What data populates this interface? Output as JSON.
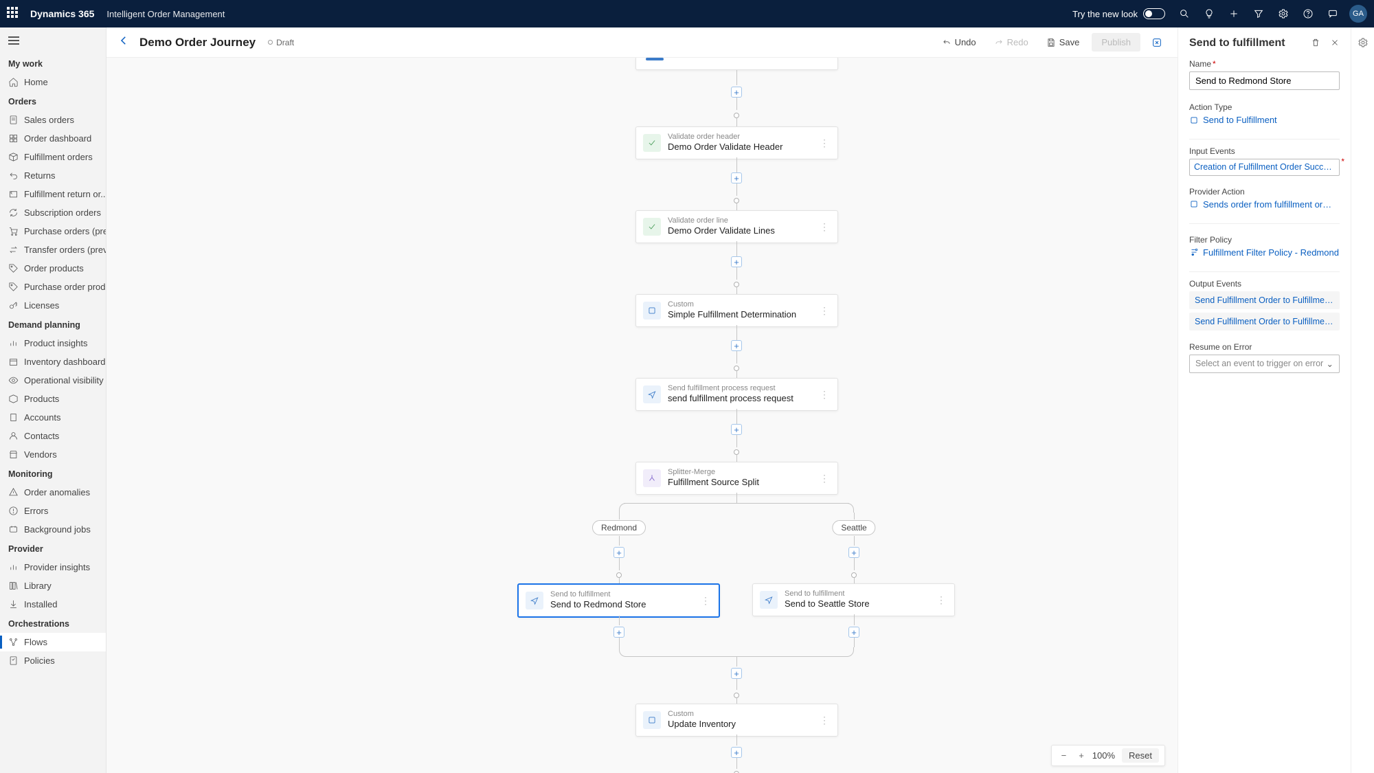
{
  "topbar": {
    "brand": "Dynamics 365",
    "module": "Intelligent Order Management",
    "trynew": "Try the new look",
    "avatar": "GA"
  },
  "sidebar": {
    "groups": [
      {
        "label": "My work",
        "items": [
          {
            "label": "Home"
          }
        ]
      },
      {
        "label": "Orders",
        "items": [
          {
            "label": "Sales orders"
          },
          {
            "label": "Order dashboard"
          },
          {
            "label": "Fulfillment orders"
          },
          {
            "label": "Returns"
          },
          {
            "label": "Fulfillment return or..."
          },
          {
            "label": "Subscription orders"
          },
          {
            "label": "Purchase orders (pre..."
          },
          {
            "label": "Transfer orders (previ..."
          },
          {
            "label": "Order products"
          },
          {
            "label": "Purchase order prod..."
          },
          {
            "label": "Licenses"
          }
        ]
      },
      {
        "label": "Demand planning",
        "items": [
          {
            "label": "Product insights"
          },
          {
            "label": "Inventory dashboard"
          },
          {
            "label": "Operational visibility ..."
          },
          {
            "label": "Products"
          },
          {
            "label": "Accounts"
          },
          {
            "label": "Contacts"
          },
          {
            "label": "Vendors"
          }
        ]
      },
      {
        "label": "Monitoring",
        "items": [
          {
            "label": "Order anomalies"
          },
          {
            "label": "Errors"
          },
          {
            "label": "Background jobs"
          }
        ]
      },
      {
        "label": "Provider",
        "items": [
          {
            "label": "Provider insights"
          },
          {
            "label": "Library"
          },
          {
            "label": "Installed"
          }
        ]
      },
      {
        "label": "Orchestrations",
        "items": [
          {
            "label": "Flows",
            "active": true
          },
          {
            "label": "Policies"
          }
        ]
      }
    ]
  },
  "cmdbar": {
    "title": "Demo Order Journey",
    "status": "Draft",
    "undo": "Undo",
    "redo": "Redo",
    "save": "Save",
    "publish": "Publish"
  },
  "nodes": {
    "n1": {
      "type": "Validate order header",
      "name": "Demo Order Validate Header"
    },
    "n2": {
      "type": "Validate order line",
      "name": "Demo Order Validate Lines"
    },
    "n3": {
      "type": "Custom",
      "name": "Simple Fulfillment Determination"
    },
    "n4": {
      "type": "Send fulfillment process request",
      "name": "send fulfillment process request"
    },
    "n5": {
      "type": "Splitter-Merge",
      "name": "Fulfillment Source Split"
    },
    "n6": {
      "type": "Send to fulfillment",
      "name": "Send to Redmond Store"
    },
    "n7": {
      "type": "Send to fulfillment",
      "name": "Send to Seattle Store"
    },
    "n8": {
      "type": "Custom",
      "name": "Update Inventory"
    },
    "branch_left": "Redmond",
    "branch_right": "Seattle"
  },
  "panel": {
    "title": "Send to fulfillment",
    "name_label": "Name",
    "name_value": "Send to Redmond Store",
    "action_type_label": "Action Type",
    "action_type_value": "Send to Fulfillment",
    "input_events_label": "Input Events",
    "input_event_chip": "Creation of Fulfillment Order Succeed...",
    "provider_action_label": "Provider Action",
    "provider_action_value": "Sends order from fulfillment order to de...",
    "filter_policy_label": "Filter Policy",
    "filter_policy_value": "Fulfillment Filter Policy - Redmond",
    "output_events_label": "Output Events",
    "output_event_1": "Send Fulfillment Order to Fulfillment ...",
    "output_event_2": "Send Fulfillment Order to Fulfillment ...",
    "resume_label": "Resume on Error",
    "resume_placeholder": "Select an event to trigger on error"
  },
  "zoom": {
    "value": "100%",
    "reset": "Reset"
  }
}
